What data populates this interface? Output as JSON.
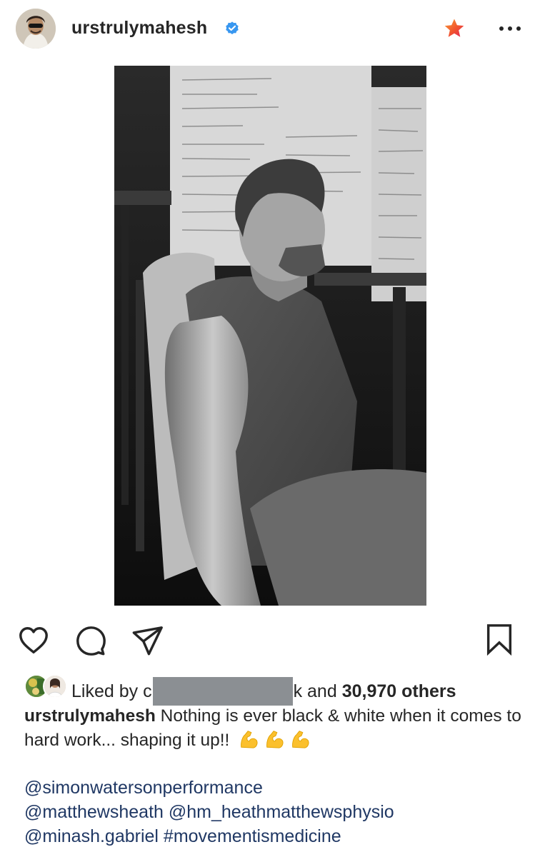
{
  "header": {
    "username": "urstrulymahesh",
    "icons": {
      "verified": "verified-badge-icon",
      "favorite": "star-icon",
      "more": "more-options-icon"
    },
    "colors": {
      "verified": "#3897f0",
      "star": "#f1582c"
    }
  },
  "post": {
    "image_description_icon": "gym-photo"
  },
  "actions": {
    "icons": [
      "heart-icon",
      "comment-icon",
      "share-icon",
      "bookmark-icon"
    ]
  },
  "likes": {
    "prefix": "Liked by",
    "middle_partial_start": "c",
    "middle_partial_end": "k",
    "suffix": "and",
    "count": "30,970 others"
  },
  "caption": {
    "username": "urstrulymahesh",
    "text": " Nothing is ever black & white when it comes to hard work... shaping it up!!",
    "emoji_count": 3
  },
  "mentions": {
    "line1": [
      "@simonwatersonperformance"
    ],
    "line2": [
      "@matthewsheath",
      "@hm_heathmatthewsphysio"
    ],
    "line3": [
      "@minash.gabriel",
      "#movementismedicine"
    ]
  }
}
